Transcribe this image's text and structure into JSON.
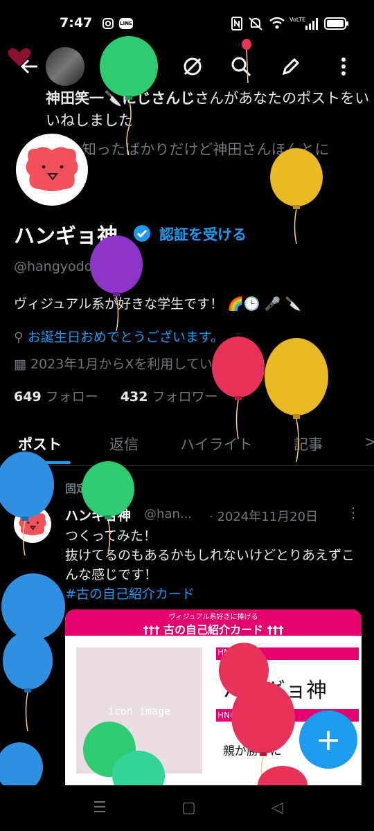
{
  "status_bar": {
    "time": "7:47",
    "icons": [
      "instagram-icon",
      "line-icon",
      "nfc-icon",
      "mute-icon",
      "wifi-icon",
      "volte-icon",
      "signal-icon",
      "battery-icon"
    ],
    "line_label": "LINE",
    "volte_label": "VoLTE"
  },
  "header": {
    "icons": [
      "back-arrow-icon",
      "grok-icon",
      "search-icon",
      "compose-icon",
      "more-vertical-icon"
    ]
  },
  "notification": {
    "user_name": "神田笑一🔪にじさんじ",
    "text_rest": "さんがあなたのポストをいいねしました",
    "preview": "知ったばかりだけど神田さんほんとに"
  },
  "profile": {
    "display_name": "ハンギョ神",
    "verify_label": "認証を受ける",
    "handle": "@hangyodon0815",
    "bio": "ヴィジュアル系が好きな学生です！ 🌈🕒 🎤 🔪",
    "birthday": "お誕生日おめでとうございます。",
    "joined": "2023年1月からXを利用しています",
    "following_count": "649",
    "following_label": "フォロー",
    "followers_count": "432",
    "followers_label": "フォロワー"
  },
  "tabs": [
    {
      "label": "ポスト",
      "active": true
    },
    {
      "label": "返信",
      "active": false
    },
    {
      "label": "ハイライト",
      "active": false
    },
    {
      "label": "記事",
      "active": false
    },
    {
      "label": ">",
      "active": false
    }
  ],
  "post": {
    "pinned_label": "固定",
    "author_name": "ハンギョ神",
    "author_handle": "@han...",
    "date": "· 2024年11月20日",
    "line1": "つくってみた！",
    "line2": "抜けてるのもあるかもしれないけどとりあえずこんな感じです！",
    "hashtag": "#古の自己紹介カード",
    "card": {
      "subtitle": "ヴィジュアル系好きに捧げる",
      "title": "††† 古の自己紹介カード †††",
      "icon_label": "icon image",
      "hn_tag": "HN",
      "hn_value": "ハンギョ神",
      "origin_tag": "HNの由来",
      "origin_text": "親が勝手に"
    }
  },
  "fab": {
    "label": "+"
  },
  "nav_bar": {
    "icons": [
      "recent-apps-icon",
      "home-icon",
      "back-icon"
    ]
  },
  "colors": {
    "accent": "#1d9bf0",
    "card_pink": "#e5006e",
    "balloon_green": "#2ecc71",
    "balloon_yellow": "#e8b923",
    "balloon_purple": "#8e35c9",
    "balloon_red": "#e8325a",
    "balloon_blue": "#2f8fe0"
  }
}
